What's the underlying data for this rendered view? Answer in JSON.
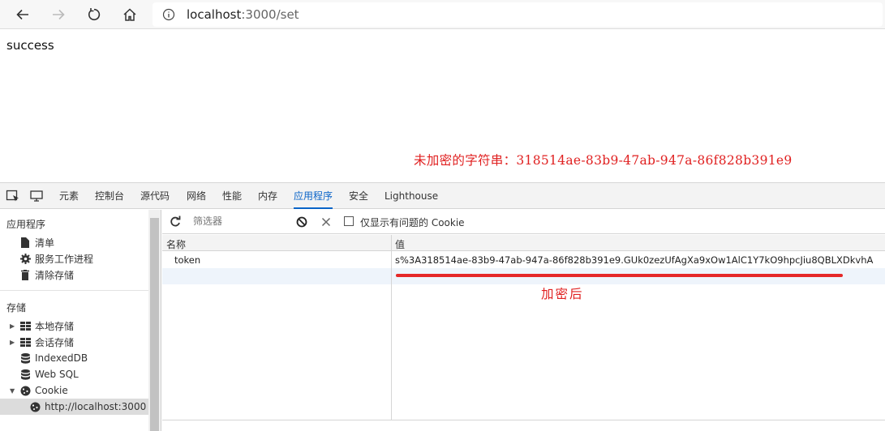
{
  "browser": {
    "url_host": "localhost",
    "url_rest": ":3000/set"
  },
  "page": {
    "message": "success",
    "annotation_top": "未加密的字符串：318514ae-83b9-47ab-947a-86f828b391e9"
  },
  "devtools": {
    "tabs": [
      "元素",
      "控制台",
      "源代码",
      "网络",
      "性能",
      "内存",
      "应用程序",
      "安全",
      "Lighthouse"
    ],
    "active_tab": "应用程序",
    "sidebar": {
      "app_title": "应用程序",
      "app_items": [
        "清单",
        "服务工作进程",
        "清除存储"
      ],
      "storage_title": "存储",
      "storage_items": [
        "本地存储",
        "会话存储",
        "IndexedDB",
        "Web SQL",
        "Cookie"
      ],
      "cookie_child": "http://localhost:3000"
    },
    "filter": {
      "placeholder": "筛选器",
      "only_issues_label": "仅显示有问题的 Cookie"
    },
    "table": {
      "col_name": "名称",
      "col_value": "值",
      "rows": [
        {
          "name": "token",
          "value": "s%3A318514ae-83b9-47ab-947a-86f828b391e9.GUk0zezUfAgXa9xOw1AlC1Y7kO9hpcJiu8QBLXDkvhA"
        }
      ]
    },
    "annotation_bottom": "加密后"
  }
}
